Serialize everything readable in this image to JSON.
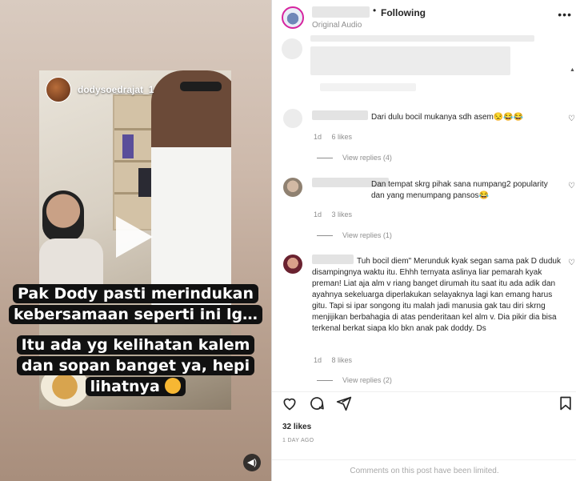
{
  "media": {
    "uploader_name": "dodysoedrajat_1",
    "caption_line1": "Pak Dody pasti merindukan",
    "caption_line2": "kebersamaan seperti ini lg…",
    "caption_line3": "Itu ada yg kelihatan kalem",
    "caption_line4": "dan sopan banget ya, hepi",
    "caption_line5": "lihatnya",
    "play_icon": "play-icon",
    "mute_icon": "speaker-icon"
  },
  "header": {
    "separator": "•",
    "follow_state": "Following",
    "audio_label": "Original Audio",
    "more_icon": "•••"
  },
  "comments": [
    {
      "text": "Dari dulu bocil mukanya sdh asem😒😂😂",
      "age": "1d",
      "likes": "6 likes",
      "replies": "View replies (4)"
    },
    {
      "text": "Dan tempat skrg pihak sana numpang2 popularity dan yang menumpang pansos😂",
      "age": "1d",
      "likes": "3 likes",
      "replies": "View replies (1)"
    },
    {
      "text": "Tuh bocil diem\" Merunduk kyak segan sama pak D duduk disampingnya waktu itu. Ehhh ternyata aslinya liar pemarah kyak preman! Liat aja alm v riang banget dirumah itu saat itu ada adik dan ayahnya sekeluarga diperlakukan selayaknya lagi kan emang harus gitu. Tapi si ipar songong itu malah jadi manusia gak tau diri skrng menjijikan berbahagia di atas penderitaan kel alm v. Dia pikir dia bisa terkenal berkat siapa klo bkn anak pak doddy. Ds",
      "age": "1d",
      "likes": "8 likes",
      "replies": "View replies (2)"
    }
  ],
  "footer": {
    "likes": "32 likes",
    "date": "1 DAY AGO",
    "limited_notice": "Comments on this post have been limited."
  },
  "colors": {
    "text": "#262626",
    "muted": "#8e8e8e",
    "border": "#dbdbdb"
  }
}
